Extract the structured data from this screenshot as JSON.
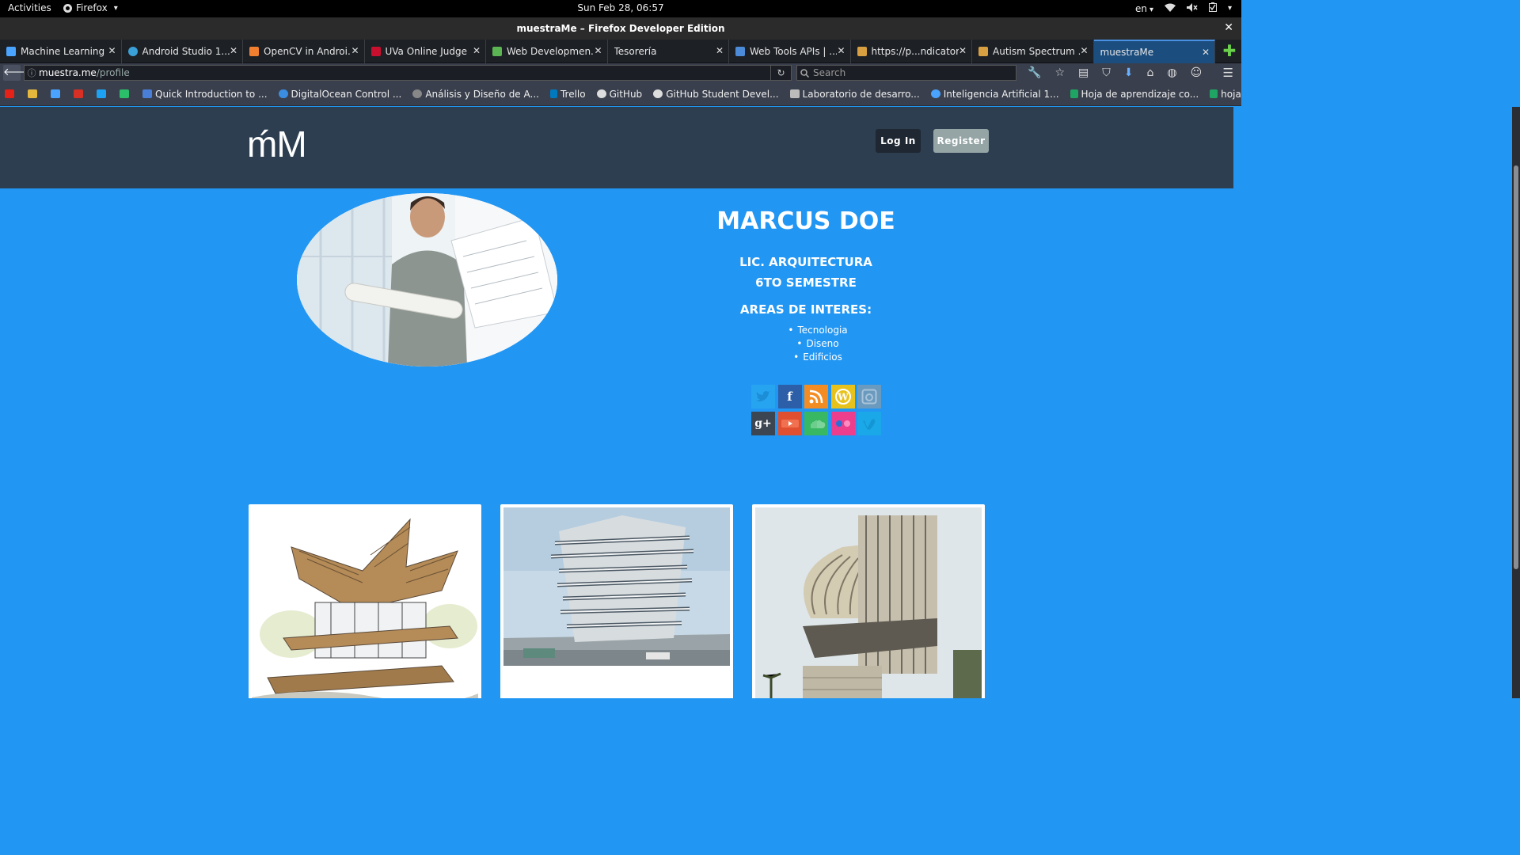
{
  "system_bar": {
    "activities": "Activities",
    "app": "Firefox",
    "clock": "Sun Feb 28, 06:57",
    "lang": "en"
  },
  "window": {
    "title": "muestraMe – Firefox Developer Edition"
  },
  "tabs": [
    {
      "label": "Machine Learning ...",
      "icon_color": "#4aa3ff"
    },
    {
      "label": "Android Studio 1....",
      "icon_color": "#3aa0d8"
    },
    {
      "label": "OpenCV in Androi...",
      "icon_color": "#f08030"
    },
    {
      "label": "UVa Online Judge",
      "icon_color": "#c8102e"
    },
    {
      "label": "Web Developmen...",
      "icon_color": "#5ab552"
    },
    {
      "label": "Tesorería",
      "icon_color": ""
    },
    {
      "label": "Web Tools APIs | ...",
      "icon_color": "#4b8bd8"
    },
    {
      "label": "https://p...ndicator/",
      "icon_color": "#d8a040"
    },
    {
      "label": "Autism Spectrum ...",
      "icon_color": "#d8a040"
    },
    {
      "label": "muestraMe",
      "icon_color": ""
    }
  ],
  "nav": {
    "url_host": "muestra.me",
    "url_path": "/profile",
    "search_placeholder": "Search"
  },
  "bookmarks": [
    {
      "label": "",
      "icon_color": "#e62117"
    },
    {
      "label": "",
      "icon_color": "#e5b83d"
    },
    {
      "label": "",
      "icon_color": "#4aa3ff"
    },
    {
      "label": "",
      "icon_color": "#d93025"
    },
    {
      "label": "",
      "icon_color": "#1da1f2"
    },
    {
      "label": "",
      "icon_color": "#2bbf6a"
    },
    {
      "label": "Quick Introduction to ...",
      "icon_color": "#4a7fd8"
    },
    {
      "label": "DigitalOcean Control ...",
      "icon_color": "#3a8de0"
    },
    {
      "label": "Análisis y Diseño de A...",
      "icon_color": "#888888"
    },
    {
      "label": "Trello",
      "icon_color": "#0079bf"
    },
    {
      "label": "GitHub",
      "icon_color": "#dddddd"
    },
    {
      "label": "GitHub Student Devel...",
      "icon_color": "#dddddd"
    },
    {
      "label": "Laboratorio de desarro...",
      "icon_color": "#bbbbbb"
    },
    {
      "label": "Inteligencia Artificial 1...",
      "icon_color": "#4aa3ff"
    },
    {
      "label": "Hoja de aprendizaje co...",
      "icon_color": "#1fa463"
    },
    {
      "label": "hoja aprendizajes (indi...",
      "icon_color": "#1fa463"
    }
  ],
  "site": {
    "logo": "ḿM",
    "login": "Log In",
    "register": "Register",
    "header_bg": "#2c3e50",
    "page_bg": "#2196f3"
  },
  "profile": {
    "name": "MARCUS DOE",
    "career": "LIC. ARQUITECTURA",
    "semester": "6TO SEMESTRE",
    "areas_title": "AREAS DE INTERES:",
    "interests": [
      "Tecnologia",
      "Diseno",
      "Edificios"
    ]
  },
  "social": [
    {
      "name": "twitter-icon",
      "color": "#27a4f0",
      "glyph": ""
    },
    {
      "name": "facebook-icon",
      "color": "#2d5fa8",
      "glyph": "f"
    },
    {
      "name": "rss-icon",
      "color": "#f48c24",
      "glyph": ""
    },
    {
      "name": "wordpress-icon",
      "color": "#e8c21c",
      "glyph": "W"
    },
    {
      "name": "instagram-icon",
      "color": "#6b9abf",
      "glyph": ""
    },
    {
      "name": "google-plus-icon",
      "color": "#3b4652",
      "glyph": "g+"
    },
    {
      "name": "youtube-icon",
      "color": "#e05030",
      "glyph": ""
    },
    {
      "name": "soundcloud-icon",
      "color": "#39b863",
      "glyph": ""
    },
    {
      "name": "flickr-icon",
      "color": "#ec3e8c",
      "glyph": "••"
    },
    {
      "name": "vimeo-icon",
      "color": "#1aa8e8",
      "glyph": ""
    }
  ]
}
